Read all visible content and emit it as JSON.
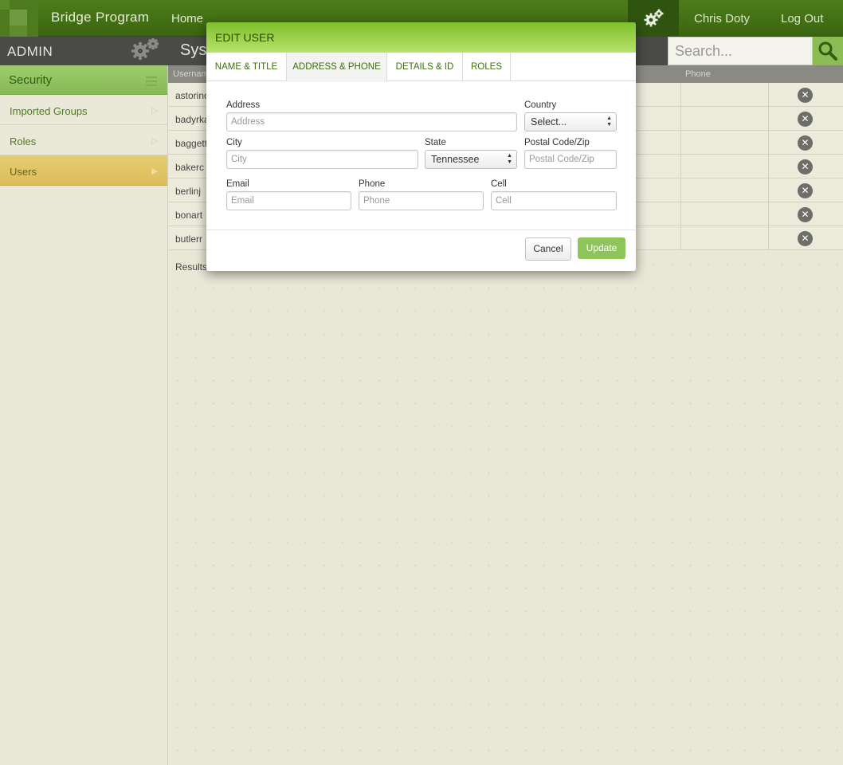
{
  "topbar": {
    "app_title": "Bridge Program",
    "home_label": "Home",
    "user_name": "Chris Doty",
    "logout_label": "Log Out"
  },
  "adminbar": {
    "label": "ADMIN"
  },
  "sidebar": {
    "section_title": "Security",
    "items": [
      {
        "label": "Imported Groups"
      },
      {
        "label": "Roles"
      },
      {
        "label": "Users"
      }
    ]
  },
  "main": {
    "title": "Syst",
    "search_placeholder": "Search...",
    "columns": {
      "username": "Usernam",
      "phone": "Phone"
    },
    "rows": [
      "astorino",
      "badyrka",
      "baggett",
      "bakerc",
      "berlinj",
      "bonart",
      "butlerr"
    ],
    "results_label": "Results:"
  },
  "modal": {
    "title": "EDIT USER",
    "tabs": [
      "NAME & TITLE",
      "ADDRESS & PHONE",
      "DETAILS & ID",
      "ROLES"
    ],
    "active_tab": "ADDRESS & PHONE",
    "fields": {
      "address_label": "Address",
      "address_placeholder": "Address",
      "country_label": "Country",
      "country_value": "Select...",
      "city_label": "City",
      "city_placeholder": "City",
      "state_label": "State",
      "state_value": "Tennessee",
      "zip_label": "Postal Code/Zip",
      "zip_placeholder": "Postal Code/Zip",
      "email_label": "Email",
      "email_placeholder": "Email",
      "phone_label": "Phone",
      "phone_placeholder": "Phone",
      "cell_label": "Cell",
      "cell_placeholder": "Cell"
    },
    "cancel_label": "Cancel",
    "update_label": "Update"
  },
  "colors": {
    "brand_green": "#3f6a13",
    "accent_green": "#8dc55a",
    "active_yellow": "#dcbd5a"
  }
}
